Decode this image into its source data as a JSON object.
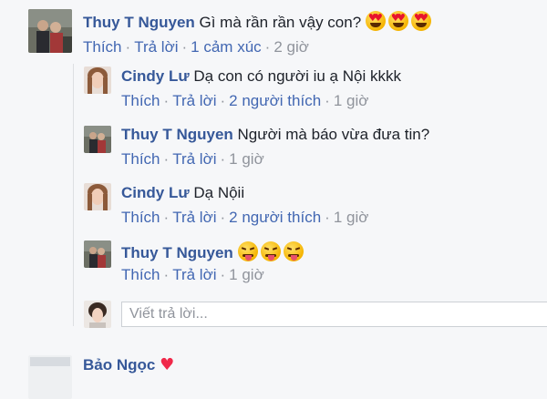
{
  "comment": {
    "author": "Thuy T Nguyen",
    "text": "Gì mà rần rần vậy con?",
    "emojis": [
      "heart-eyes",
      "heart-eyes",
      "heart-eyes"
    ],
    "like_label": "Thích",
    "reply_label": "Trả lời",
    "reactions": "1 cảm xúc",
    "time": "2 giờ"
  },
  "replies": [
    {
      "author": "Cindy Lư",
      "text": "Dạ con có người iu ạ Nội kkkk",
      "like_label": "Thích",
      "reply_label": "Trả lời",
      "likes": "2 người thích",
      "time": "1 giờ"
    },
    {
      "author": "Thuy T Nguyen",
      "text": "Người mà báo vừa đưa tin?",
      "like_label": "Thích",
      "reply_label": "Trả lời",
      "time": "1 giờ"
    },
    {
      "author": "Cindy Lư",
      "text": "Dạ Nộii",
      "like_label": "Thích",
      "reply_label": "Trả lời",
      "likes": "2 người thích",
      "time": "1 giờ"
    },
    {
      "author": "Thuy T Nguyen",
      "text": "",
      "emojis": [
        "tongue",
        "tongue",
        "tongue"
      ],
      "like_label": "Thích",
      "reply_label": "Trả lời",
      "time": "1 giờ"
    }
  ],
  "reply_input": {
    "placeholder": "Viết trả lời..."
  },
  "next_comment": {
    "author": "Bảo Ngọc"
  },
  "colors": {
    "name": "#365899",
    "link": "#4267b2",
    "muted": "#90949c",
    "background": "#f6f7f9"
  }
}
